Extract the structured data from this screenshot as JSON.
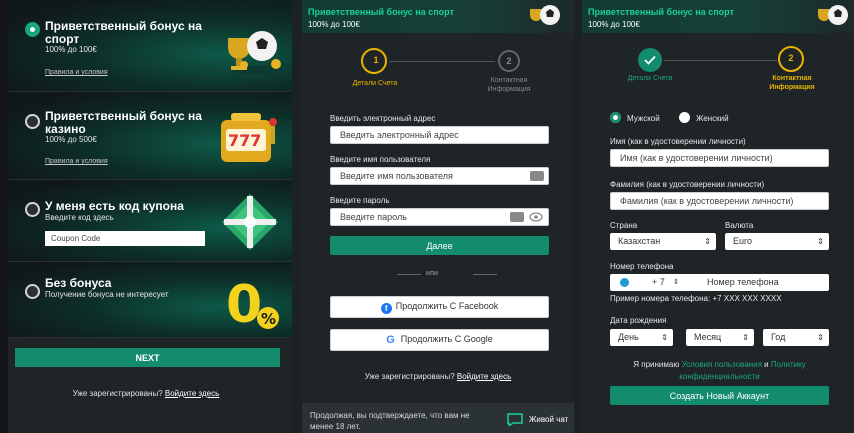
{
  "panel1": {
    "bonuses": [
      {
        "title": "Приветственный бонус на спорт",
        "subtitle": "100% до 100€",
        "link": "Правила и условия",
        "selected": true
      },
      {
        "title": "Приветственный бонус на казино",
        "subtitle": "100% до 500€",
        "link": "Правила и условия",
        "selected": false
      },
      {
        "title": "У меня есть код купона",
        "subtitle": "Введите код здесь",
        "placeholder": "Coupon Code",
        "selected": false
      },
      {
        "title": "Без бонуса",
        "subtitle": "Получение бонуса не интересует",
        "selected": false
      }
    ],
    "next_label": "NEXT",
    "registered_text": "Уже зарегистрированы?",
    "login_link": "Войдите здесь"
  },
  "panel2": {
    "header_title": "Приветственный бонус на спорт",
    "header_sub": "100% до 100€",
    "step1_num": "1",
    "step1_label": "Детали Счета",
    "step2_num": "2",
    "step2_label_1": "Контактная",
    "step2_label_2": "Информация",
    "email_label": "Введить электронный адрес",
    "email_placeholder": "Введить электронный адрес",
    "username_label": "Введите имя пользователя",
    "username_placeholder": "Введите имя пользователя",
    "password_label": "Введите пароль",
    "password_placeholder": "Введите пароль",
    "submit_label": "Далее",
    "or_text": "или",
    "facebook_label": "Продолжить С Facebook",
    "google_label": "Продолжить С Google",
    "registered_text": "Уже зарегистрированы?",
    "login_link": "Войдите здесь",
    "footer_text_1": "Продолжая, вы подтверждаете, что вам не",
    "footer_text_2": "менее 18 лет.",
    "live_chat": "Живой чат"
  },
  "panel3": {
    "header_title": "Приветственный бонус на спорт",
    "header_sub": "100% до 100€",
    "step1_label": "Детали Счета",
    "step2_num": "2",
    "step2_label_1": "Контактная",
    "step2_label_2": "Информация",
    "gender_male": "Мужской",
    "gender_female": "Женский",
    "first_name_label": "Имя (как в удостоверении личности)",
    "first_name_placeholder": "Имя (как в удостоверении личности)",
    "last_name_label": "Фамилия (как в удостоверении личности)",
    "last_name_placeholder": "Фамилия (как в удостоверении личности)",
    "country_label": "Страна",
    "country_value": "Казахстан",
    "currency_label": "Валюта",
    "currency_value": "Euro",
    "phone_label": "Номер телефона",
    "phone_code": "+ 7",
    "phone_placeholder": "Номер телефона",
    "phone_example": "Пример номера телефона: +7 XXX XXX XXXX",
    "dob_label": "Дата рождения",
    "dob_day": "День",
    "dob_month": "Месяц",
    "dob_year": "Год",
    "accept_1": "Я принимаю",
    "accept_terms": "Условия пользования",
    "accept_and": "и",
    "accept_policy": "Политику",
    "accept_policy2": "конфиденциальности",
    "create_label": "Создать Новый Аккаунт"
  },
  "colors": {
    "accent": "#138b6d",
    "accent_text": "#1ad19a",
    "step_active": "#e8b400",
    "background": "#1f2427"
  }
}
